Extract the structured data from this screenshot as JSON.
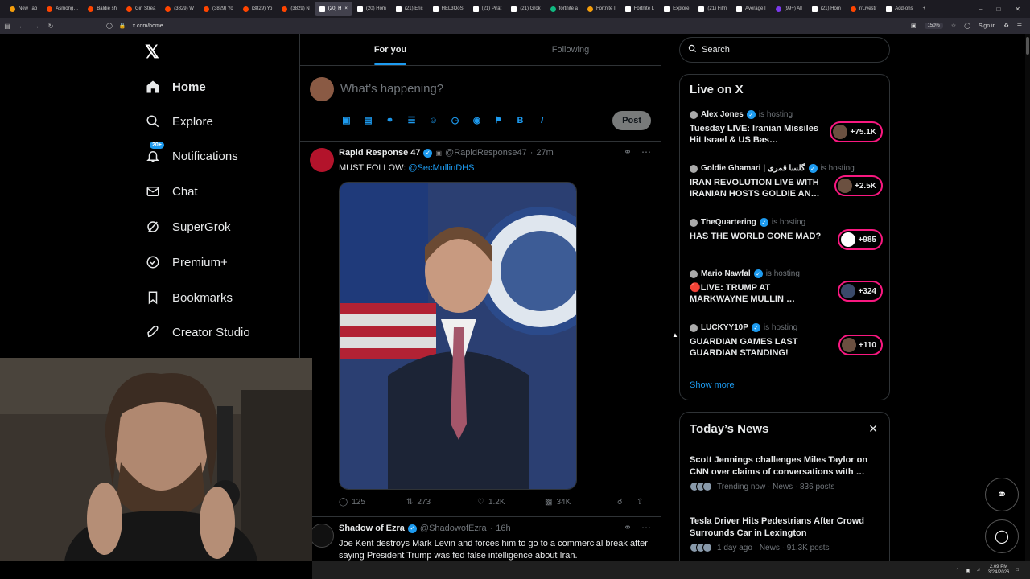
{
  "browser": {
    "tabs": [
      {
        "label": "New Tab",
        "fav": "o"
      },
      {
        "label": "Asmong…",
        "fav": "r"
      },
      {
        "label": "Baldie sh",
        "fav": "r"
      },
      {
        "label": "Girl Strea",
        "fav": "r"
      },
      {
        "label": "(3829) W",
        "fav": "r"
      },
      {
        "label": "(3829) Yo",
        "fav": "r"
      },
      {
        "label": "(3829) Yo",
        "fav": "r"
      },
      {
        "label": "(3829) N",
        "fav": "r"
      },
      {
        "label": "(20) H",
        "fav": "x",
        "active": true
      },
      {
        "label": "(20) Hom",
        "fav": "x"
      },
      {
        "label": "(21) Eric",
        "fav": "x"
      },
      {
        "label": "HEL3OoS",
        "fav": "x"
      },
      {
        "label": "(21) Pirat",
        "fav": "x"
      },
      {
        "label": "(21) Grok",
        "fav": "x"
      },
      {
        "label": "fortnite a",
        "fav": "g"
      },
      {
        "label": "Fortnite I",
        "fav": "o"
      },
      {
        "label": "Fortnite L",
        "fav": "x"
      },
      {
        "label": "Explore",
        "fav": "x"
      },
      {
        "label": "(21) Film",
        "fav": "x"
      },
      {
        "label": "Average I",
        "fav": "x"
      },
      {
        "label": "(99+) All",
        "fav": "p"
      },
      {
        "label": "(21) Hom",
        "fav": "x"
      },
      {
        "label": "r/Livestr",
        "fav": "r"
      },
      {
        "label": "Add-ons",
        "fav": "x"
      }
    ],
    "url": "x.com/home",
    "zoom": "150%",
    "sign_in": "Sign in"
  },
  "nav": {
    "home": "Home",
    "explore": "Explore",
    "notifications": "Notifications",
    "notifications_badge": "20+",
    "chat": "Chat",
    "supergrok": "SuperGrok",
    "premium": "Premium+",
    "bookmarks": "Bookmarks",
    "creator_studio": "Creator Studio"
  },
  "feed": {
    "tab_for_you": "For you",
    "tab_following": "Following",
    "composer_placeholder": "What’s happening?",
    "post_button": "Post",
    "tweets": [
      {
        "name": "Rapid Response 47",
        "handle": "@RapidResponse47",
        "time": "27m",
        "text": "MUST FOLLOW: ",
        "mention": "@SecMullinDHS",
        "replies": "125",
        "reposts": "273",
        "likes": "1.2K",
        "views": "34K"
      },
      {
        "name": "Shadow of Ezra",
        "handle": "@ShadowofEzra",
        "time": "16h",
        "text": "Joe Kent destroys Mark Levin and forces him to go to a commercial break after saying President Trump was fed false intelligence about Iran."
      }
    ]
  },
  "sidebar": {
    "search_placeholder": "Search",
    "live_title": "Live on X",
    "is_hosting": "is hosting",
    "live": [
      {
        "host": "Alex Jones",
        "title": "Tuesday LIVE: Iranian Missiles Hit Israel & US Bas…",
        "count": "+75.1K"
      },
      {
        "host": "Goldie Ghamari | گلسا قمری",
        "title": "IRAN REVOLUTION LIVE WITH IRANIAN HOSTS GOLDIE AN…",
        "count": "+2.5K"
      },
      {
        "host": "TheQuartering",
        "title": "HAS THE WORLD GONE MAD?",
        "count": "+985"
      },
      {
        "host": "Mario Nawfal",
        "title": "🔴LIVE: TRUMP AT MARKWAYNE MULLIN …",
        "count": "+324"
      },
      {
        "host": "LUCKYY10P",
        "title": "GUARDIAN GAMES LAST GUARDIAN STANDING!",
        "count": "+110"
      }
    ],
    "show_more": "Show more",
    "news_title": "Today’s News",
    "news": [
      {
        "title": "Scott Jennings challenges Miles Taylor on CNN over claims of conversations with …",
        "meta": "Trending now · News · 836 posts"
      },
      {
        "title": "Tesla Driver Hits Pedestrians After Crowd Surrounds Car in Lexington",
        "meta": "1 day ago · News · 91.3K posts"
      }
    ]
  },
  "taskbar": {
    "time": "2:09 PM",
    "date": "3/24/2026"
  }
}
